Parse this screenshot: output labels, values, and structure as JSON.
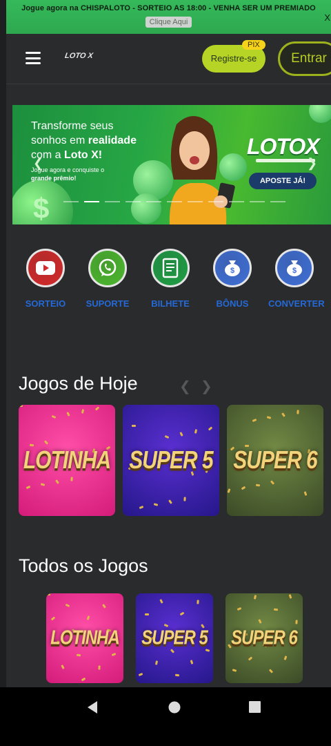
{
  "promo": {
    "text": "Jogue agora na CHISPALOTO - SORTEIO AS 18:00 - VENHA SER UM PREMIADO",
    "button": "Clique Aqui",
    "close": "X"
  },
  "header": {
    "logo": "LOTO X",
    "register": "Registre-se",
    "pix_badge": "PIX",
    "enter": "Entrar"
  },
  "banner": {
    "headline_1": "Transforme seus",
    "headline_2": "sonhos em ",
    "headline_2b": "realidade",
    "headline_3": "com a ",
    "headline_3b": "Loto X!",
    "sub_1": "Jogue agora e conquiste o",
    "sub_2": "grande prêmio!",
    "brand": "LOTOX",
    "cta": "APOSTE JÁ!",
    "slide_count": 11,
    "active_slide": 1
  },
  "quick_actions": [
    {
      "label": "SORTEIO",
      "icon": "youtube-icon",
      "color": "#d42a2a"
    },
    {
      "label": "SUPORTE",
      "icon": "whatsapp-icon",
      "color": "#4cb82e"
    },
    {
      "label": "BILHETE",
      "icon": "ticket-icon",
      "color": "#1f9f45"
    },
    {
      "label": "BÔNUS",
      "icon": "money-bag-icon",
      "color": "#3f6fd6"
    },
    {
      "label": "CONVERTER",
      "icon": "money-bag-icon",
      "color": "#3f6fd6"
    }
  ],
  "sections": {
    "today": "Jogos de Hoje",
    "all": "Todos os Jogos"
  },
  "games_today": [
    "LOTINHA",
    "SUPER 5",
    "SUPER 6"
  ],
  "games_all": [
    "LOTINHA",
    "SUPER 5",
    "SUPER 6"
  ],
  "colors": {
    "accent": "#b6d425",
    "promo_bg": "#35b95a",
    "link_blue": "#2569d6"
  }
}
